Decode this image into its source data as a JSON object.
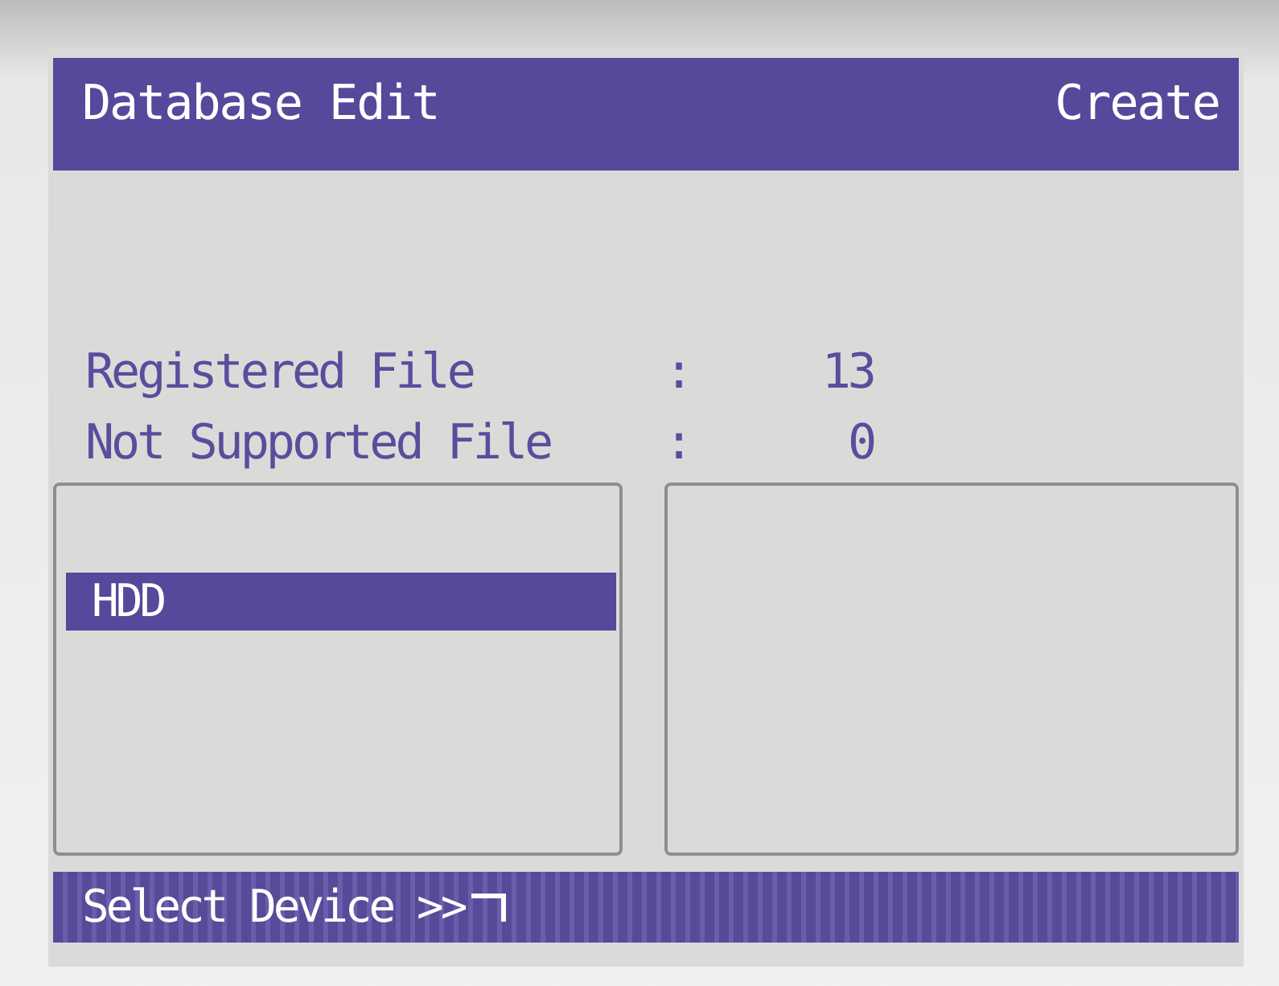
{
  "header": {
    "title": "Database Edit",
    "mode": "Create"
  },
  "stats": [
    {
      "label": "Registered File",
      "separator": ":",
      "value": "13"
    },
    {
      "label": "Not Supported File",
      "separator": ":",
      "value": "0"
    }
  ],
  "devices": [
    {
      "label": "HDD",
      "selected": true
    }
  ],
  "status_bar": {
    "text": "Select Device >>"
  }
}
